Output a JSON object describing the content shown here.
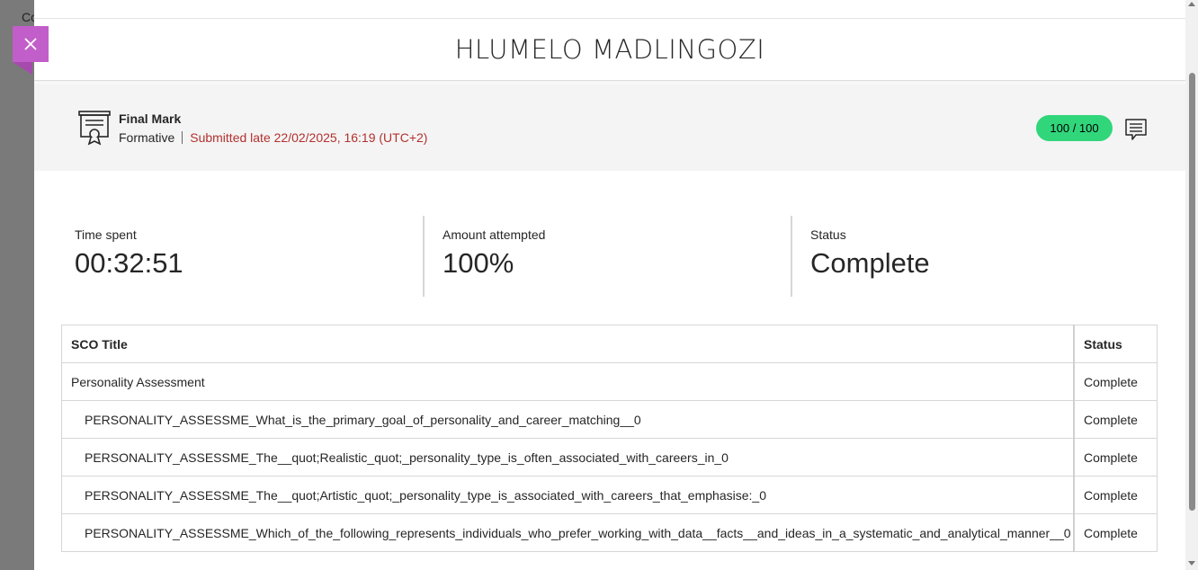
{
  "background": {
    "partial_text": "Co"
  },
  "header": {
    "student_name": "HLUMELO MADLINGOZI"
  },
  "grade": {
    "title": "Final Mark",
    "category": "Formative",
    "submission": "Submitted late 22/02/2025, 16:19 (UTC+2)",
    "score": "100 / 100",
    "icons": {
      "certificate": "certificate-icon",
      "feedback": "feedback-comment-icon"
    },
    "colors": {
      "score_pill": "#31d67b",
      "late_text": "#b3312e"
    }
  },
  "stats": [
    {
      "label": "Time spent",
      "value": "00:32:51"
    },
    {
      "label": "Amount attempted",
      "value": "100%"
    },
    {
      "label": "Status",
      "value": "Complete"
    }
  ],
  "table": {
    "headers": {
      "title": "SCO Title",
      "status": "Status"
    },
    "rows": [
      {
        "title": "Personality Assessment",
        "status": "Complete"
      },
      {
        "title": "PERSONALITY_ASSESSME_What_is_the_primary_goal_of_personality_and_career_matching__0",
        "status": "Complete"
      },
      {
        "title": "PERSONALITY_ASSESSME_The__quot;Realistic_quot;_personality_type_is_often_associated_with_careers_in_0",
        "status": "Complete"
      },
      {
        "title": "PERSONALITY_ASSESSME_The__quot;Artistic_quot;_personality_type_is_associated_with_careers_that_emphasise:_0",
        "status": "Complete"
      },
      {
        "title": "PERSONALITY_ASSESSME_Which_of_the_following_represents_individuals_who_prefer_working_with_data__facts__and_ideas_in_a_systematic_and_analytical_manner__0",
        "status": "Complete"
      }
    ]
  },
  "accent_color": "#c25ec9"
}
